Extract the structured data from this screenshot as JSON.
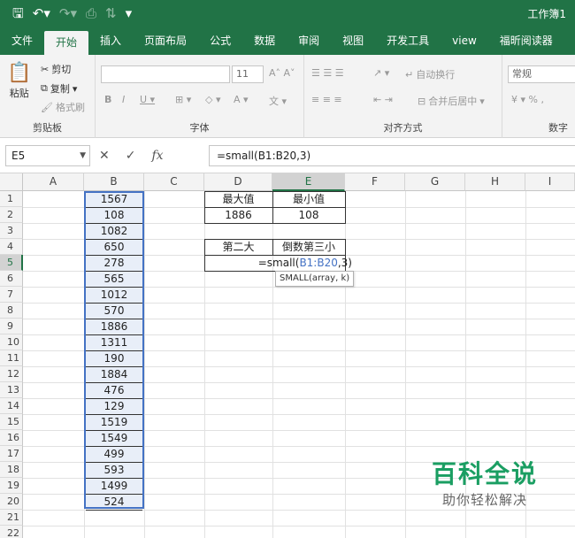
{
  "window": {
    "title": "工作簿1"
  },
  "tabs": [
    "文件",
    "开始",
    "插入",
    "页面布局",
    "公式",
    "数据",
    "审阅",
    "视图",
    "开发工具",
    "view",
    "福昕阅读器"
  ],
  "ribbon": {
    "clipboard": {
      "label": "剪贴板",
      "paste": "粘贴",
      "cut": "剪切",
      "copy": "复制",
      "format_painter": "格式刷"
    },
    "font": {
      "label": "字体",
      "size": "11"
    },
    "align": {
      "label": "对齐方式",
      "wrap": "自动换行",
      "merge": "合并后居中"
    },
    "number": {
      "label": "数字",
      "format": "常规"
    }
  },
  "formula_bar": {
    "name_box": "E5",
    "formula": "=small(B1:B20,3)"
  },
  "columns": [
    "A",
    "B",
    "C",
    "D",
    "E",
    "F",
    "G",
    "H",
    "I"
  ],
  "rows": [
    "1",
    "2",
    "3",
    "4",
    "5",
    "6",
    "7",
    "8",
    "9",
    "10",
    "11",
    "12",
    "13",
    "14",
    "15",
    "16",
    "17",
    "18",
    "19",
    "20",
    "21",
    "22"
  ],
  "column_b": [
    "1567",
    "108",
    "1082",
    "650",
    "278",
    "565",
    "1012",
    "570",
    "1886",
    "1311",
    "190",
    "1884",
    "476",
    "129",
    "1519",
    "1549",
    "499",
    "593",
    "1499",
    "524"
  ],
  "table1": {
    "d1": "最大值",
    "e1": "最小值",
    "d2": "1886",
    "e2": "108"
  },
  "table2": {
    "d4": "第二大",
    "e4": "倒数第三小"
  },
  "edit": {
    "prefix": "=small(",
    "ref": "B1:B20",
    "suffix": ",3)"
  },
  "tooltip": "SMALL(array, k)",
  "watermark": {
    "title": "百科全说",
    "subtitle": "助你轻松解决"
  },
  "accent": "#217346"
}
